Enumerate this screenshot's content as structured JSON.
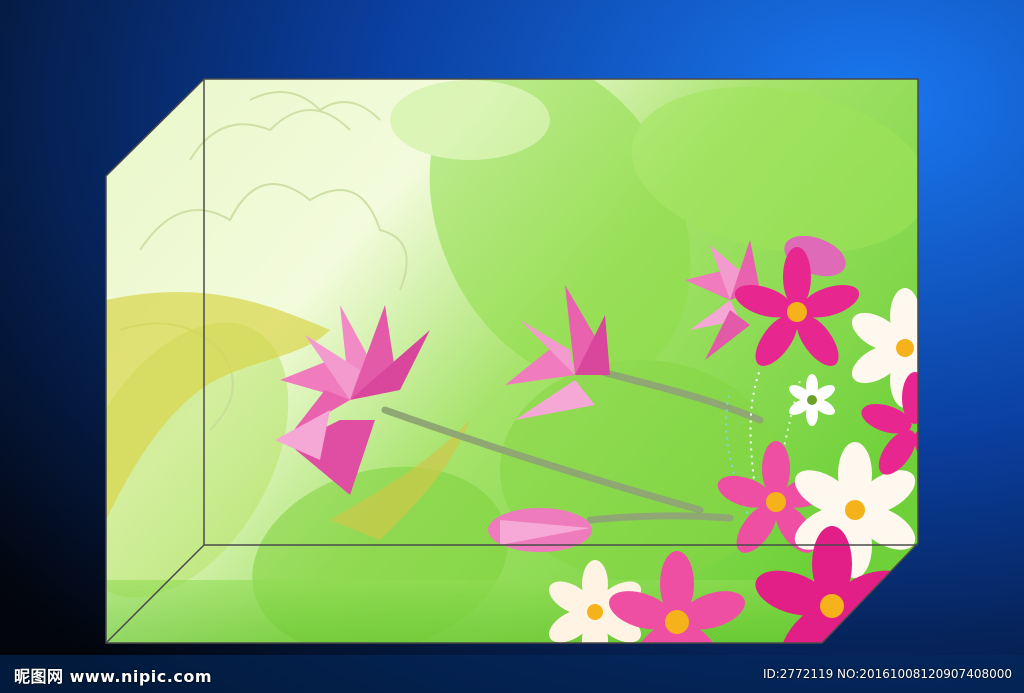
{
  "watermark": {
    "logo_text": "昵图网 www.nipic.com",
    "id_text": "ID:2772119 NO:20161008120907408000"
  },
  "colors": {
    "bg_dark": "#02050c",
    "bg_blue": "#0b5fd8",
    "panel_light": "#f3fbdc",
    "panel_green": "#7fd93f",
    "lotus_pink": "#ee6fb5",
    "cosmos_magenta": "#e8268f",
    "cosmos_white": "#fff8ee",
    "flower_center": "#f5b21b",
    "stem": "#8fa873",
    "frame_line": "#555555"
  }
}
